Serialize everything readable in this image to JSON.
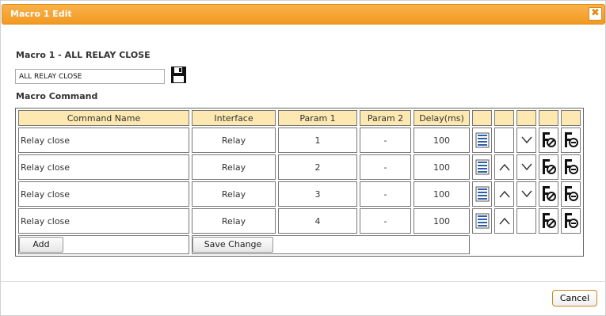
{
  "window": {
    "title": "Macro 1 Edit",
    "close_label": "✖"
  },
  "macro": {
    "heading": "Macro 1 - ALL RELAY CLOSE",
    "name_value": "ALL RELAY CLOSE"
  },
  "section": {
    "label": "Macro Command"
  },
  "table": {
    "headers": [
      "Command Name",
      "Interface",
      "Param 1",
      "Param 2",
      "Delay(ms)"
    ],
    "rows": [
      {
        "name": "Relay close",
        "interface": "Relay",
        "param1": "1",
        "param2": "-",
        "delay": "100",
        "up": false,
        "down": true
      },
      {
        "name": "Relay close",
        "interface": "Relay",
        "param1": "2",
        "param2": "-",
        "delay": "100",
        "up": true,
        "down": true
      },
      {
        "name": "Relay close",
        "interface": "Relay",
        "param1": "3",
        "param2": "-",
        "delay": "100",
        "up": true,
        "down": true
      },
      {
        "name": "Relay close",
        "interface": "Relay",
        "param1": "4",
        "param2": "-",
        "delay": "100",
        "up": true,
        "down": false
      }
    ]
  },
  "buttons": {
    "add": "Add",
    "save_change": "Save Change",
    "cancel": "Cancel"
  },
  "icons": {
    "save": "floppy-disk-icon",
    "list": "list-icon",
    "up": "chevron-up-icon",
    "down": "chevron-down-icon",
    "edit": "edit-icon",
    "remove": "remove-icon"
  },
  "colors": {
    "title_bar": "#f29a22",
    "header_bg": "#fce8b0"
  }
}
